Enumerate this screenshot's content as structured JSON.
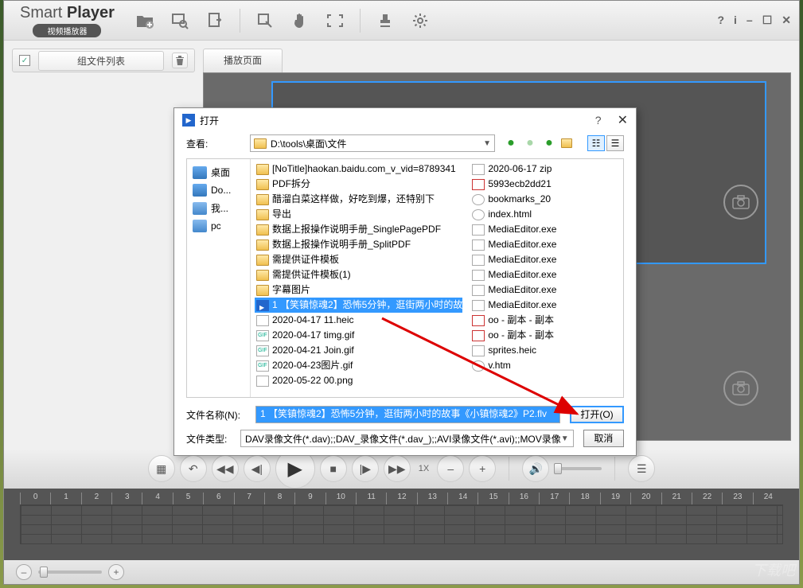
{
  "app": {
    "title_prefix": "Smart ",
    "title_bold": "Player",
    "subtitle": "视频播放器"
  },
  "win_controls": {
    "help": "?",
    "info": "i",
    "min": "–",
    "max": "☐",
    "close": "✕"
  },
  "sidebar": {
    "group_label": "组文件列表"
  },
  "tabs": {
    "play_page": "播放页面"
  },
  "controls": {
    "speed": "1X"
  },
  "ruler": [
    "0",
    "1",
    "2",
    "3",
    "4",
    "5",
    "6",
    "7",
    "8",
    "9",
    "10",
    "11",
    "12",
    "13",
    "14",
    "15",
    "16",
    "17",
    "18",
    "19",
    "20",
    "21",
    "22",
    "23",
    "24"
  ],
  "dialog": {
    "title": "打开",
    "look_in_label": "查看:",
    "path": "D:\\tools\\桌面\\文件",
    "places": [
      {
        "label": "桌面"
      },
      {
        "label": "Do..."
      },
      {
        "label": "我..."
      },
      {
        "label": "pc"
      }
    ],
    "files_col1": [
      {
        "icon": "fold",
        "name": "[NoTitle]haokan.baidu.com_v_vid=8789341"
      },
      {
        "icon": "fold",
        "name": "PDF拆分"
      },
      {
        "icon": "fold",
        "name": "醋溜白菜这样做，好吃到爆，还特别下"
      },
      {
        "icon": "fold",
        "name": "导出"
      },
      {
        "icon": "fold",
        "name": "数据上报操作说明手册_SinglePagePDF"
      },
      {
        "icon": "fold",
        "name": "数据上报操作说明手册_SplitPDF"
      },
      {
        "icon": "fold",
        "name": "需提供证件模板"
      },
      {
        "icon": "fold",
        "name": "需提供证件模板(1)"
      },
      {
        "icon": "fold",
        "name": "字幕图片"
      },
      {
        "icon": "vid",
        "name": "1 【笑镇惊魂2】恐怖5分钟，逛街两小时的故事《小镇惊魂2》P2.flv",
        "selected": true
      },
      {
        "icon": "doc",
        "name": "2020-04-17 11.heic"
      },
      {
        "icon": "gif",
        "name": "2020-04-17 timg.gif"
      },
      {
        "icon": "gif",
        "name": "2020-04-21 Join.gif"
      },
      {
        "icon": "gif",
        "name": "2020-04-23图片.gif"
      },
      {
        "icon": "png",
        "name": "2020-05-22 00.png"
      }
    ],
    "files_col2": [
      {
        "icon": "zip",
        "name": "2020-06-17 zip"
      },
      {
        "icon": "pdf",
        "name": "5993ecb2dd21"
      },
      {
        "icon": "chr",
        "name": "bookmarks_20"
      },
      {
        "icon": "chr",
        "name": "index.html"
      },
      {
        "icon": "doc",
        "name": "MediaEditor.exe"
      },
      {
        "icon": "doc",
        "name": "MediaEditor.exe"
      },
      {
        "icon": "doc",
        "name": "MediaEditor.exe"
      },
      {
        "icon": "doc",
        "name": "MediaEditor.exe"
      },
      {
        "icon": "doc",
        "name": "MediaEditor.exe"
      },
      {
        "icon": "doc",
        "name": "MediaEditor.exe"
      },
      {
        "icon": "pdf",
        "name": "oo - 副本 - 副本"
      },
      {
        "icon": "pdf",
        "name": "oo - 副本 - 副本"
      },
      {
        "icon": "doc",
        "name": "sprites.heic"
      },
      {
        "icon": "chr",
        "name": "v.htm"
      }
    ],
    "filename_label": "文件名称(N):",
    "filename_value": "1 【笑镇惊魂2】恐怖5分钟，逛街两小时的故事《小镇惊魂2》P2.flv",
    "filetype_label": "文件类型:",
    "filetype_value": "DAV录像文件(*.dav);;DAV_录像文件(*.dav_);;AVI录像文件(*.avi);;MOV录像",
    "open_btn": "打开(O)",
    "cancel_btn": "取消"
  },
  "watermark": "下载吧"
}
